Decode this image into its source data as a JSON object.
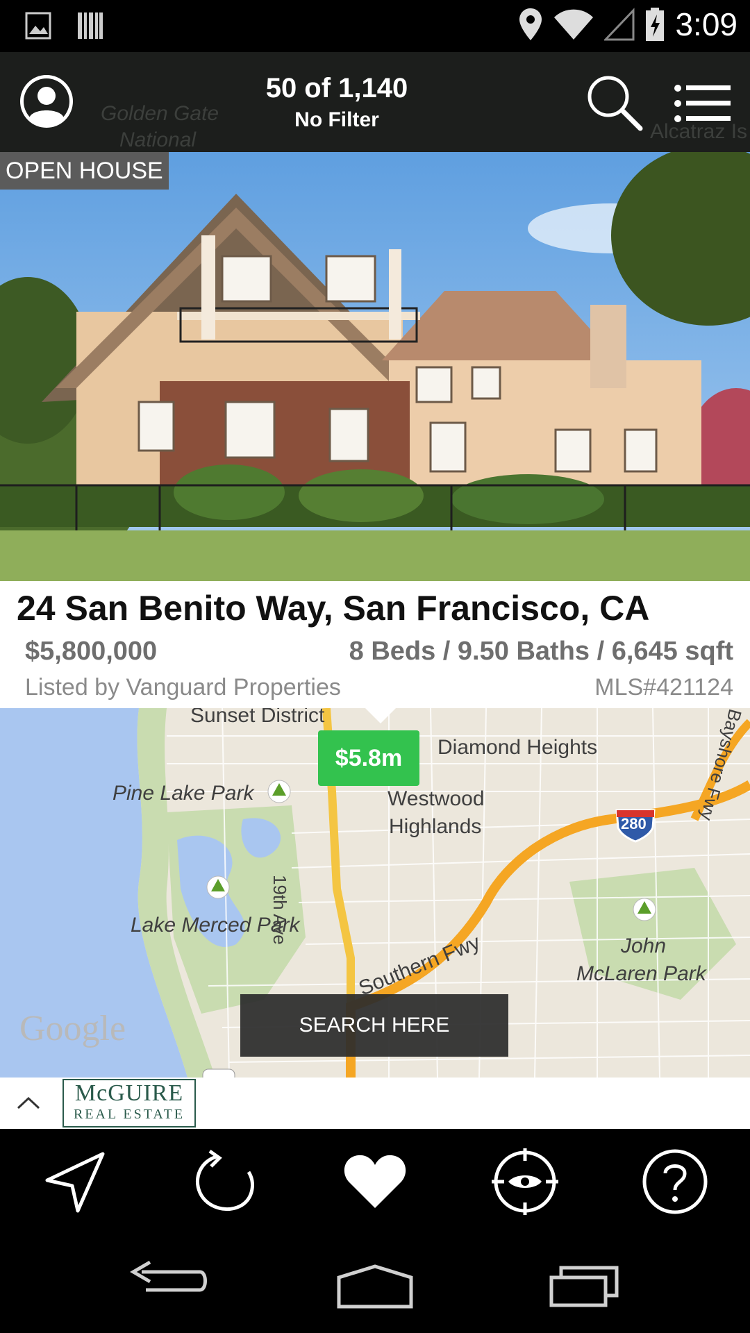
{
  "status_bar": {
    "time": "3:09",
    "icons": [
      "image-icon",
      "barcode-icon",
      "location-icon",
      "wifi-icon",
      "signal-icon",
      "battery-charging-icon"
    ]
  },
  "header": {
    "count": "50 of 1,140",
    "filter": "No Filter",
    "map_ghost_labels": [
      "Golden Gate",
      "National",
      "Alcatraz Is"
    ],
    "icons": [
      "profile-icon",
      "search-icon",
      "menu-icon"
    ]
  },
  "listing": {
    "badge": "OPEN HOUSE",
    "address": "24 San Benito Way, San Francisco, CA",
    "price": "$5,800,000",
    "specs": "8 Beds / 9.50 Baths / 6,645 sqft",
    "listed_by": "Listed by Vanguard Properties",
    "mls": "MLS#421124"
  },
  "map": {
    "price_pin": "$5.8m",
    "labels": {
      "sunset": "Sunset District",
      "diamond": "Diamond Heights",
      "pine_lake": "Pine Lake Park",
      "westwood_1": "Westwood",
      "westwood_2": "Highlands",
      "ave19": "19th Ave",
      "lake_merced": "Lake Merced Park",
      "southern_fwy": "Southern Fwy",
      "john": "John",
      "mclaren": "McLaren Park",
      "bayshore": "Bayshore Fwy",
      "hwy280": "280"
    },
    "google_logo": "Google",
    "search_here": "SEARCH HERE",
    "colors": {
      "water": "#a9c6f0",
      "park": "#c9dcb0",
      "freeway": "#f5a623",
      "pin": "#33c24e"
    }
  },
  "ad": {
    "logo_line1": "McGUIRE",
    "logo_line2": "REAL ESTATE"
  },
  "actions": [
    "navigate-icon",
    "refresh-icon",
    "heart-icon",
    "target-eye-icon",
    "help-icon"
  ],
  "nav": [
    "back-icon",
    "home-icon",
    "recents-icon"
  ]
}
